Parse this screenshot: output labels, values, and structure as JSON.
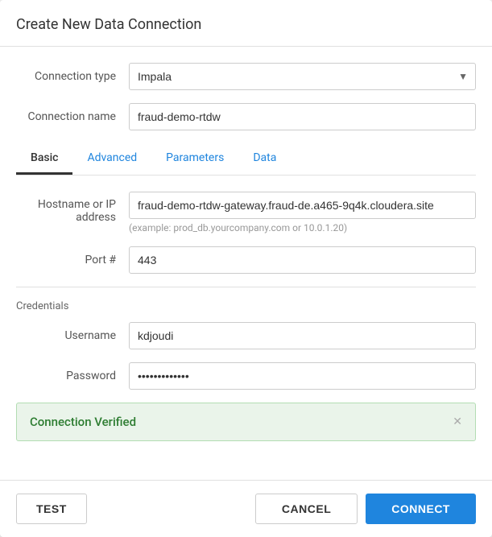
{
  "dialog": {
    "title": "Create New Data Connection"
  },
  "form": {
    "connection_type_label": "Connection type",
    "connection_type_value": "Impala",
    "connection_name_label": "Connection name",
    "connection_name_value": "fraud-demo-rtdw",
    "tabs": [
      {
        "id": "basic",
        "label": "Basic",
        "active": true
      },
      {
        "id": "advanced",
        "label": "Advanced",
        "active": false
      },
      {
        "id": "parameters",
        "label": "Parameters",
        "active": false
      },
      {
        "id": "data",
        "label": "Data",
        "active": false
      }
    ],
    "hostname_label": "Hostname or IP address",
    "hostname_value": "fraud-demo-rtdw-gateway.fraud-de.a465-9q4k.cloudera.site",
    "hostname_hint": "(example: prod_db.yourcompany.com or 10.0.1.20)",
    "port_label": "Port #",
    "port_value": "443",
    "credentials_label": "Credentials",
    "username_label": "Username",
    "username_value": "kdjoudi",
    "password_label": "Password",
    "password_value": "•••••••••••••"
  },
  "banner": {
    "text": "Connection Verified"
  },
  "footer": {
    "test_label": "TEST",
    "cancel_label": "CANCEL",
    "connect_label": "CONNECT"
  }
}
